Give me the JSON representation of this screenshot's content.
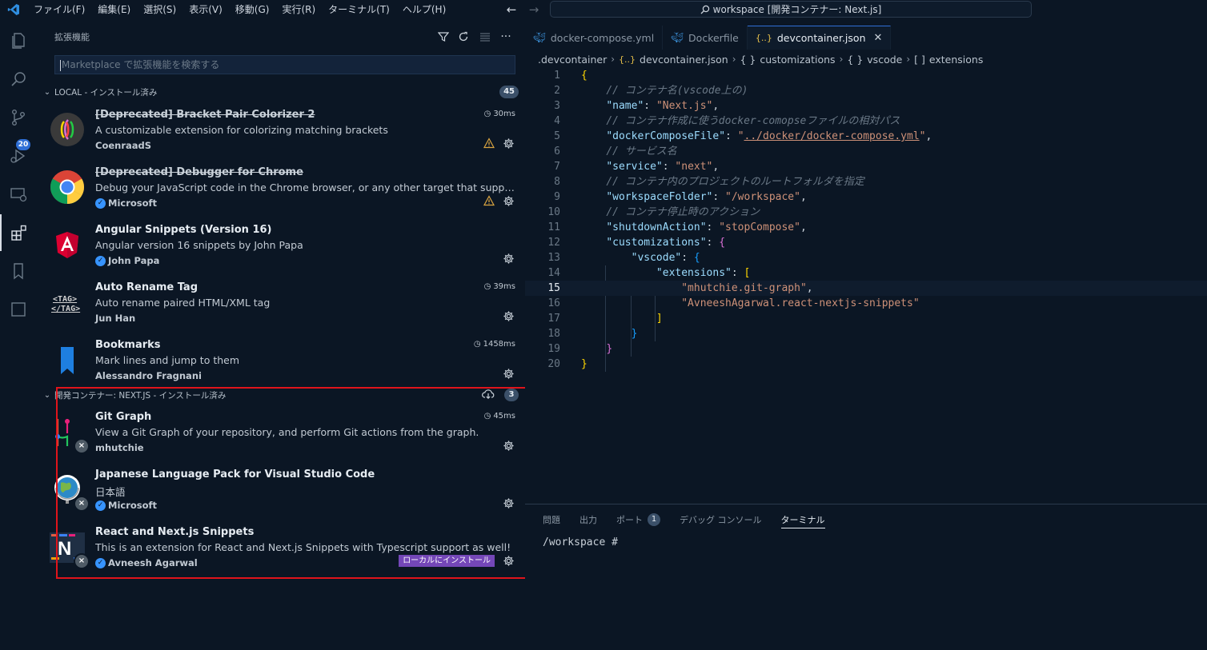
{
  "titlebar": {
    "menus": [
      "ファイル(F)",
      "編集(E)",
      "選択(S)",
      "表示(V)",
      "移動(G)",
      "実行(R)",
      "ターミナル(T)",
      "ヘルプ(H)"
    ],
    "command_center": "workspace [開発コンテナー: Next.js]"
  },
  "activitybar": {
    "scm_badge": "20"
  },
  "sidebar": {
    "title": "拡張機能",
    "search_placeholder": "Marketplace で拡張機能を検索する",
    "local_section": {
      "label": "LOCAL - インストール済み",
      "count": "45"
    },
    "local_extensions": [
      {
        "name": "[Deprecated] Bracket Pair Colorizer 2",
        "description": "A customizable extension for colorizing matching brackets",
        "publisher": "CoenraadS",
        "time": "30ms"
      },
      {
        "name": "[Deprecated] Debugger for Chrome",
        "description": "Debug your JavaScript code in the Chrome browser, or any other target that supports the ...",
        "publisher": "Microsoft"
      },
      {
        "name": "Angular Snippets (Version 16)",
        "description": "Angular version 16 snippets by John Papa",
        "publisher": "John Papa"
      },
      {
        "name": "Auto Rename Tag",
        "description": "Auto rename paired HTML/XML tag",
        "publisher": "Jun Han",
        "time": "39ms"
      },
      {
        "name": "Bookmarks",
        "description": "Mark lines and jump to them",
        "publisher": "Alessandro Fragnani",
        "time": "1458ms"
      }
    ],
    "container_section": {
      "label": "開発コンテナー: NEXT.JS - インストール済み",
      "count": "3"
    },
    "container_extensions": [
      {
        "name": "Git Graph",
        "description": "View a Git Graph of your repository, and perform Git actions from the graph.",
        "publisher": "mhutchie",
        "time": "45ms"
      },
      {
        "name": "Japanese Language Pack for Visual Studio Code",
        "description": "日本語",
        "publisher": "Microsoft"
      },
      {
        "name": "React and Next.js Snippets",
        "description": "This is an extension for React and Next.js Snippets with Typescript support as well!",
        "publisher": "Avneesh Agarwal",
        "action_label": "ローカルにインストール"
      }
    ]
  },
  "editor": {
    "tabs": [
      "docker-compose.yml",
      "Dockerfile",
      "devcontainer.json"
    ],
    "breadcrumb": [
      ".devcontainer",
      "devcontainer.json",
      "customizations",
      "vscode",
      "extensions"
    ],
    "breadcrumb_glyphs": [
      "{..}",
      "{ }",
      "{ }",
      "[ ]"
    ],
    "line_numbers": [
      "1",
      "2",
      "3",
      "4",
      "5",
      "6",
      "7",
      "8",
      "9",
      "10",
      "11",
      "12",
      "13",
      "14",
      "15",
      "16",
      "17",
      "18",
      "19",
      "20"
    ],
    "current_line": "15",
    "code": {
      "l1": "{",
      "l2_comment": "// コンテナ名(vscode上の)",
      "l3_key": "\"name\"",
      "l3_val": "\"Next.js\"",
      "l4_comment": "// コンテナ作成に使うdocker-comopseファイルの相対パス",
      "l5_key": "\"dockerComposeFile\"",
      "l5_q": "\"",
      "l5_link": "../docker/docker-compose.yml",
      "l6_comment": "// サービス名",
      "l7_key": "\"service\"",
      "l7_val": "\"next\"",
      "l8_comment": "// コンテナ内のプロジェクトのルートフォルダを指定",
      "l9_key": "\"workspaceFolder\"",
      "l9_val": "\"/workspace\"",
      "l10_comment": "// コンテナ停止時のアクション",
      "l11_key": "\"shutdownAction\"",
      "l11_val": "\"stopCompose\"",
      "l12_key": "\"customizations\"",
      "l12_br": "{",
      "l13_key": "\"vscode\"",
      "l13_br": "{",
      "l14_key": "\"extensions\"",
      "l14_br": "[",
      "l15_val": "\"mhutchie.git-graph\"",
      "l16_val": "\"AvneeshAgarwal.react-nextjs-snippets\"",
      "l17": "]",
      "l18": "}",
      "l19": "}",
      "l20": "}"
    }
  },
  "panel": {
    "tabs": [
      "問題",
      "出力",
      "ポート",
      "デバッグ コンソール",
      "ターミナル"
    ],
    "ports_badge": "1",
    "terminal_prompt": "/workspace #"
  },
  "colors": {
    "accent": "#2f6fd6",
    "highlight_box": "#e0141b",
    "install_button": "#7447b8"
  }
}
